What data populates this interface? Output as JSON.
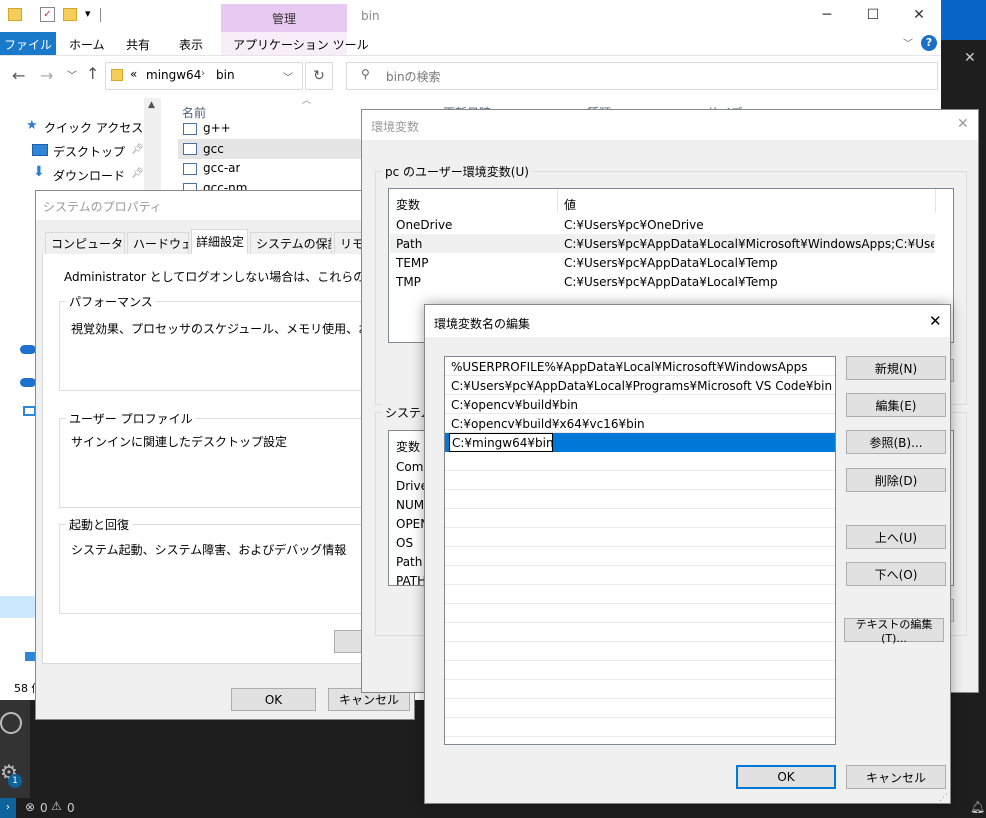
{
  "explorer": {
    "quick_access_toolbar": {
      "dropdown": "▾"
    },
    "manage_tab": "管理",
    "window_title": "bin",
    "ribbon_tabs": [
      "ファイル",
      "ホーム",
      "共有",
      "表示",
      "アプリケーション ツール"
    ],
    "help": "?",
    "breadcrumb": {
      "overflow": "«",
      "parts": [
        "mingw64",
        "bin"
      ]
    },
    "search_placeholder": "binの検索",
    "column_headers": {
      "name": "名前",
      "date": "更新日時",
      "type": "種類",
      "size": "サイズ"
    },
    "nav_items": [
      "クイック アクセス",
      "デスクトップ",
      "ダウンロード"
    ],
    "files": [
      "g++",
      "gcc",
      "gcc-ar",
      "gcc-nm"
    ],
    "status_count": "58 個"
  },
  "sysprops": {
    "title": "システムのプロパティ",
    "tabs": [
      "コンピューター名",
      "ハードウェア",
      "詳細設定",
      "システムの保護",
      "リモート"
    ],
    "admin_note": "Administrator としてログオンしない場合は、これらのほとんどは変更できません。",
    "groups": [
      {
        "label": "パフォーマンス",
        "desc": "視覚効果、プロセッサのスケジュール、メモリ使用、および仮想メモリ"
      },
      {
        "label": "ユーザー プロファイル",
        "desc": "サインインに関連したデスクトップ設定"
      },
      {
        "label": "起動と回復",
        "desc": "システム起動、システム障害、およびデバッグ情報"
      }
    ],
    "ok": "OK",
    "cancel": "キャンセル"
  },
  "envvars": {
    "title": "環境変数",
    "user_group": "pc のユーザー環境変数(U)",
    "col_var": "変数",
    "col_val": "値",
    "user_vars": [
      {
        "name": "OneDrive",
        "value": "C:¥Users¥pc¥OneDrive"
      },
      {
        "name": "Path",
        "value": "C:¥Users¥pc¥AppData¥Local¥Microsoft¥WindowsApps;C:¥Users¥pc..."
      },
      {
        "name": "TEMP",
        "value": "C:¥Users¥pc¥AppData¥Local¥Temp"
      },
      {
        "name": "TMP",
        "value": "C:¥Users¥pc¥AppData¥Local¥Temp"
      }
    ],
    "system_group": "システム環境変数(S)",
    "system_vars": [
      "ComSpec",
      "DriverData",
      "NUMBER_OF_PROCESSORS",
      "OPENCV_DIR",
      "OS",
      "Path",
      "PATHEXT"
    ]
  },
  "editdlg": {
    "title": "環境変数名の編集",
    "paths": [
      "%USERPROFILE%¥AppData¥Local¥Microsoft¥WindowsApps",
      "C:¥Users¥pc¥AppData¥Local¥Programs¥Microsoft VS Code¥bin",
      "C:¥opencv¥build¥bin",
      "C:¥opencv¥build¥x64¥vc16¥bin",
      "C:¥mingw64¥bin"
    ],
    "buttons": {
      "new": "新規(N)",
      "edit": "編集(E)",
      "browse": "参照(B)...",
      "delete": "削除(D)",
      "up": "上へ(U)",
      "down": "下へ(O)",
      "edit_text": "テキストの編集(T)...",
      "ok": "OK",
      "cancel": "キャンセル"
    }
  },
  "statusbar": {
    "errors": "0",
    "warnings": "0",
    "badge": "1"
  }
}
